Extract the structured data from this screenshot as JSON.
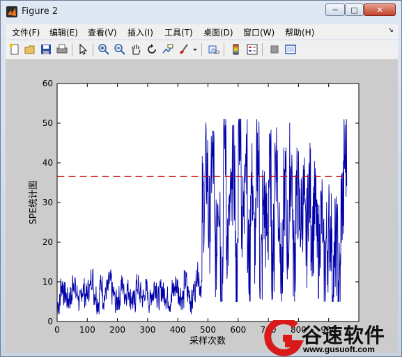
{
  "window": {
    "title": "Figure 2"
  },
  "menu": [
    "文件(F)",
    "编辑(E)",
    "查看(V)",
    "插入(I)",
    "工具(T)",
    "桌面(D)",
    "窗口(W)",
    "帮助(H)"
  ],
  "toolbar_icons": [
    "new-figure-icon",
    "open-file-icon",
    "save-icon",
    "print-icon",
    "select-arrow-icon",
    "zoom-in-icon",
    "zoom-out-icon",
    "pan-hand-icon",
    "rotate-3d-icon",
    "data-cursor-icon",
    "brush-icon",
    "brush-dropdown-icon",
    "link-plot-icon",
    "colorbar-icon",
    "legend-icon",
    "hide-plot-tools-icon",
    "show-plot-tools-icon"
  ],
  "chart_data": {
    "type": "line",
    "xlabel": "采样次数",
    "ylabel": "SPE统计图",
    "xlim": [
      0,
      1000
    ],
    "ylim": [
      0,
      60
    ],
    "xticks": [
      0,
      100,
      200,
      300,
      400,
      500,
      600,
      700,
      800,
      900
    ],
    "yticks": [
      0,
      10,
      20,
      30,
      40,
      50,
      60
    ],
    "grid": false,
    "series": [
      {
        "color": "#0000aa",
        "style": "solid",
        "x_start": 1,
        "x_step": 1,
        "n": 960,
        "description_phases": [
          {
            "x_range": [
              1,
              480
            ],
            "approx_mean": 7,
            "approx_range": [
              1,
              15
            ]
          },
          {
            "x_range": [
              481,
              960
            ],
            "approx_mean": 25,
            "approx_range": [
              5,
              51
            ]
          }
        ],
        "values_sampled_every_10": [
          4.5,
          9,
          7,
          5.5,
          6,
          10,
          7,
          5,
          8,
          6.5,
          8,
          11,
          7,
          5,
          9,
          6,
          8,
          10,
          7,
          5,
          6,
          9,
          7,
          8,
          6,
          5,
          9,
          7,
          6,
          8,
          5,
          7,
          9,
          6,
          8,
          7,
          6,
          5,
          8,
          9,
          7,
          6,
          10,
          7,
          5,
          8,
          12,
          9,
          30,
          38,
          25,
          40,
          18,
          33,
          14,
          46,
          22,
          28,
          37,
          12,
          50,
          26,
          45,
          16,
          34,
          20,
          41,
          15,
          29,
          24,
          36,
          18,
          42,
          27,
          13,
          33,
          21,
          38,
          17,
          32,
          26,
          30,
          21,
          33,
          24,
          28,
          18,
          26,
          14,
          20,
          24,
          12,
          19,
          10,
          30,
          41
        ]
      },
      {
        "color": "#cc0000",
        "style": "dashed",
        "constant": 36.6
      }
    ]
  },
  "watermark": {
    "brand": "谷速软件",
    "url": "www.gusuoft.com"
  }
}
